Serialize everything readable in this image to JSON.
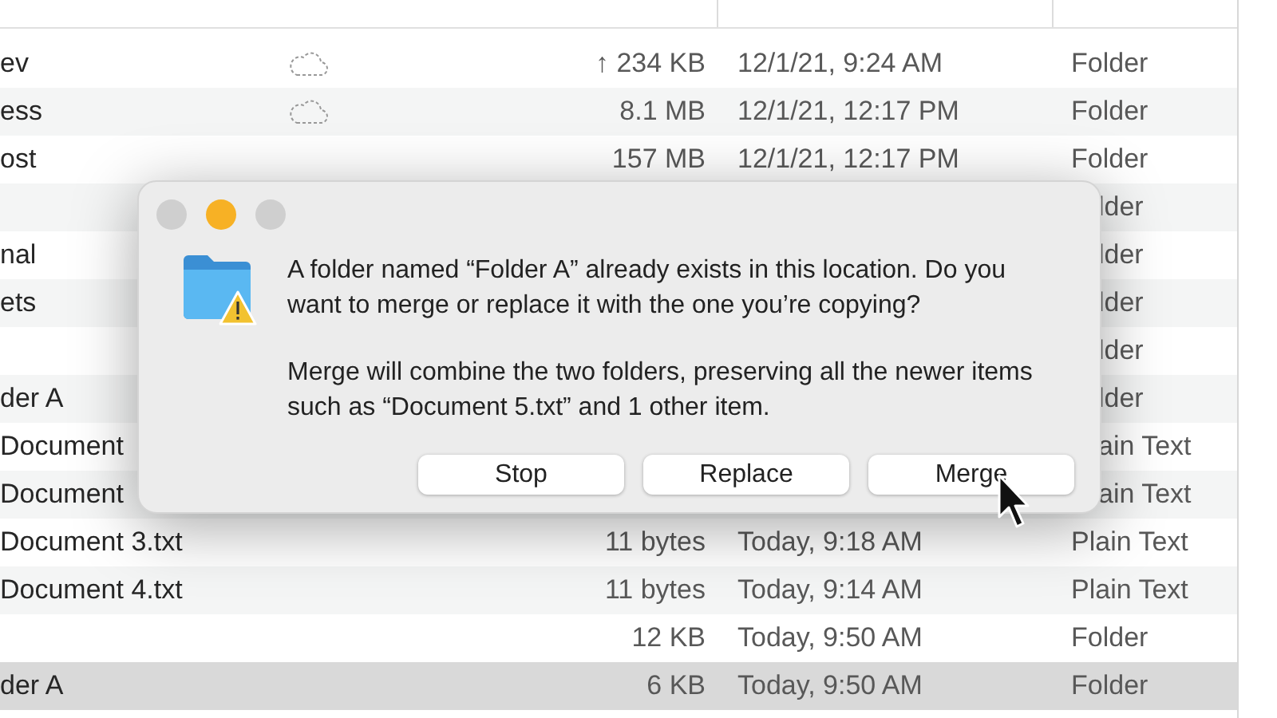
{
  "file_list": {
    "rows": [
      {
        "name": "ev",
        "icloud": true,
        "size": "↑ 234 KB",
        "date": "12/1/21, 9:24 AM",
        "kind": "Folder",
        "selected": false
      },
      {
        "name": "ess",
        "icloud": true,
        "size": "8.1 MB",
        "date": "12/1/21, 12:17 PM",
        "kind": "Folder",
        "selected": false
      },
      {
        "name": "ost",
        "icloud": false,
        "size": "157 MB",
        "date": "12/1/21, 12:17 PM",
        "kind": "Folder",
        "selected": false
      },
      {
        "icloud": false,
        "kind": "lder",
        "selected": false
      },
      {
        "name": "nal",
        "icloud": false,
        "kind": "lder",
        "selected": false
      },
      {
        "name": "ets",
        "icloud": false,
        "kind": "lder",
        "selected": false
      },
      {
        "icloud": false,
        "kind": "lder",
        "selected": false
      },
      {
        "name": "der A",
        "icloud": false,
        "kind": "lder",
        "selected": false
      },
      {
        "name": "Document",
        "icloud": false,
        "kind": "ain Text",
        "selected": false
      },
      {
        "name": "Document",
        "icloud": false,
        "kind": "ain Text",
        "selected": false
      },
      {
        "name": "Document 3.txt",
        "icloud": false,
        "size": "11 bytes",
        "date": "Today, 9:18 AM",
        "kind": "Plain Text",
        "selected": false
      },
      {
        "name": "Document 4.txt",
        "icloud": false,
        "size": "11 bytes",
        "date": "Today, 9:14 AM",
        "kind": "Plain Text",
        "selected": false
      },
      {
        "icloud": false,
        "size": "12 KB",
        "date": "Today, 9:50 AM",
        "kind": "Folder",
        "selected": false
      },
      {
        "name": "der A",
        "icloud": false,
        "size": "6 KB",
        "date": "Today, 9:50 AM",
        "kind": "Folder",
        "selected": true
      }
    ]
  },
  "dialog": {
    "message": "A folder named “Folder A” already exists in this location. Do you want to merge or replace it with the one you’re copying?",
    "detail": "Merge will combine the two folders, preserving all the newer items such as “Document 5.txt” and 1 other item.",
    "buttons": [
      "Stop",
      "Replace",
      "Merge"
    ]
  }
}
